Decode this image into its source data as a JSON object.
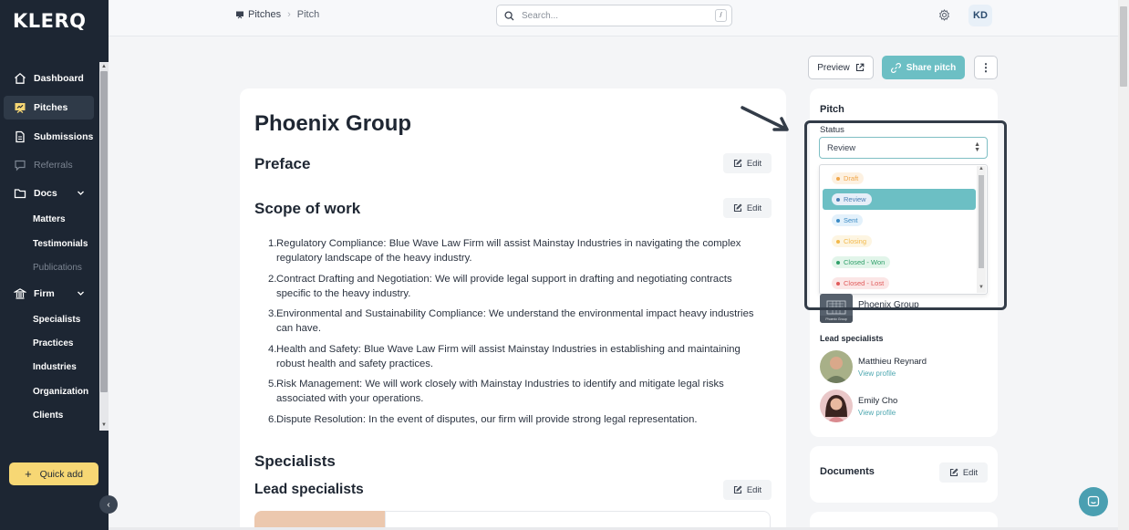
{
  "app": {
    "logo": "KLERQ"
  },
  "sidebar": {
    "items": [
      {
        "label": "Dashboard",
        "icon": "home-icon"
      },
      {
        "label": "Pitches",
        "icon": "pitches-icon",
        "active": true
      },
      {
        "label": "Submissions",
        "icon": "document-icon"
      },
      {
        "label": "Referrals",
        "icon": "chat-icon",
        "muted": true
      },
      {
        "label": "Docs",
        "icon": "folder-icon",
        "expandable": true
      },
      {
        "label": "Firm",
        "icon": "bank-icon",
        "expandable": true
      }
    ],
    "docs_sub": [
      "Matters",
      "Testimonials",
      "Publications"
    ],
    "firm_sub": [
      "Specialists",
      "Practices",
      "Industries",
      "Organization",
      "Clients"
    ],
    "quick_add": "Quick add"
  },
  "topbar": {
    "breadcrumb": [
      "Pitches",
      "Pitch"
    ],
    "search_placeholder": "Search...",
    "search_shortcut": "/",
    "avatar_initials": "KD"
  },
  "actions": {
    "preview": "Preview",
    "share": "Share pitch"
  },
  "main": {
    "title": "Phoenix Group",
    "preface": "Preface",
    "scope_title": "Scope of work",
    "edit_label": "Edit",
    "scope_items": [
      {
        "num": "1.",
        "text": "Regulatory Compliance: Blue Wave Law Firm will assist Mainstay Industries in navigating the complex regulatory landscape of the heavy industry."
      },
      {
        "num": "2.",
        "text": "Contract Drafting and Negotiation: We will provide legal support in drafting and negotiating contracts specific to the heavy industry."
      },
      {
        "num": "3.",
        "text": "Environmental and Sustainability Compliance: We understand the environmental impact heavy industries can have."
      },
      {
        "num": "4.",
        "text": "Health and Safety: Blue Wave Law Firm will assist Mainstay Industries in establishing and maintaining robust health and safety practices."
      },
      {
        "num": "5.",
        "text": "Risk Management: We will work closely with Mainstay Industries to identify and mitigate legal risks associated with your operations."
      },
      {
        "num": "6.",
        "text": "Dispute Resolution: In the event of disputes, our firm will provide strong legal representation."
      }
    ],
    "specialists_title": "Specialists",
    "lead_specialists_title": "Lead specialists"
  },
  "side_panel": {
    "title": "Pitch",
    "status_label": "Status",
    "status_value": "Review",
    "status_options": [
      {
        "label": "Draft",
        "color": "#f0a64a",
        "bg": "#fdf1e1"
      },
      {
        "label": "Review",
        "color": "#4a7fb5",
        "bg": "#e6eef8",
        "selected": true
      },
      {
        "label": "Sent",
        "color": "#3a8ac4",
        "bg": "#e3f1fb"
      },
      {
        "label": "Closing",
        "color": "#f2b84a",
        "bg": "#fdf5e2"
      },
      {
        "label": "Closed - Won",
        "color": "#2fa06a",
        "bg": "#e2f5ea"
      },
      {
        "label": "Closed - Lost",
        "color": "#e15a5a",
        "bg": "#fbe6e6"
      }
    ],
    "client_logo_caption": "Phoenix Group",
    "client_name": "Phoenix Group",
    "lead_specialists_title": "Lead specialists",
    "people": [
      {
        "name": "Matthieu Reynard",
        "link": "View profile"
      },
      {
        "name": "Emily Cho",
        "link": "View profile"
      }
    ],
    "documents_title": "Documents",
    "documents_edit": "Edit"
  },
  "colors": {
    "sidebar_bg": "#1d2633",
    "accent": "#6cbfc4",
    "quick_add": "#f7d774"
  }
}
